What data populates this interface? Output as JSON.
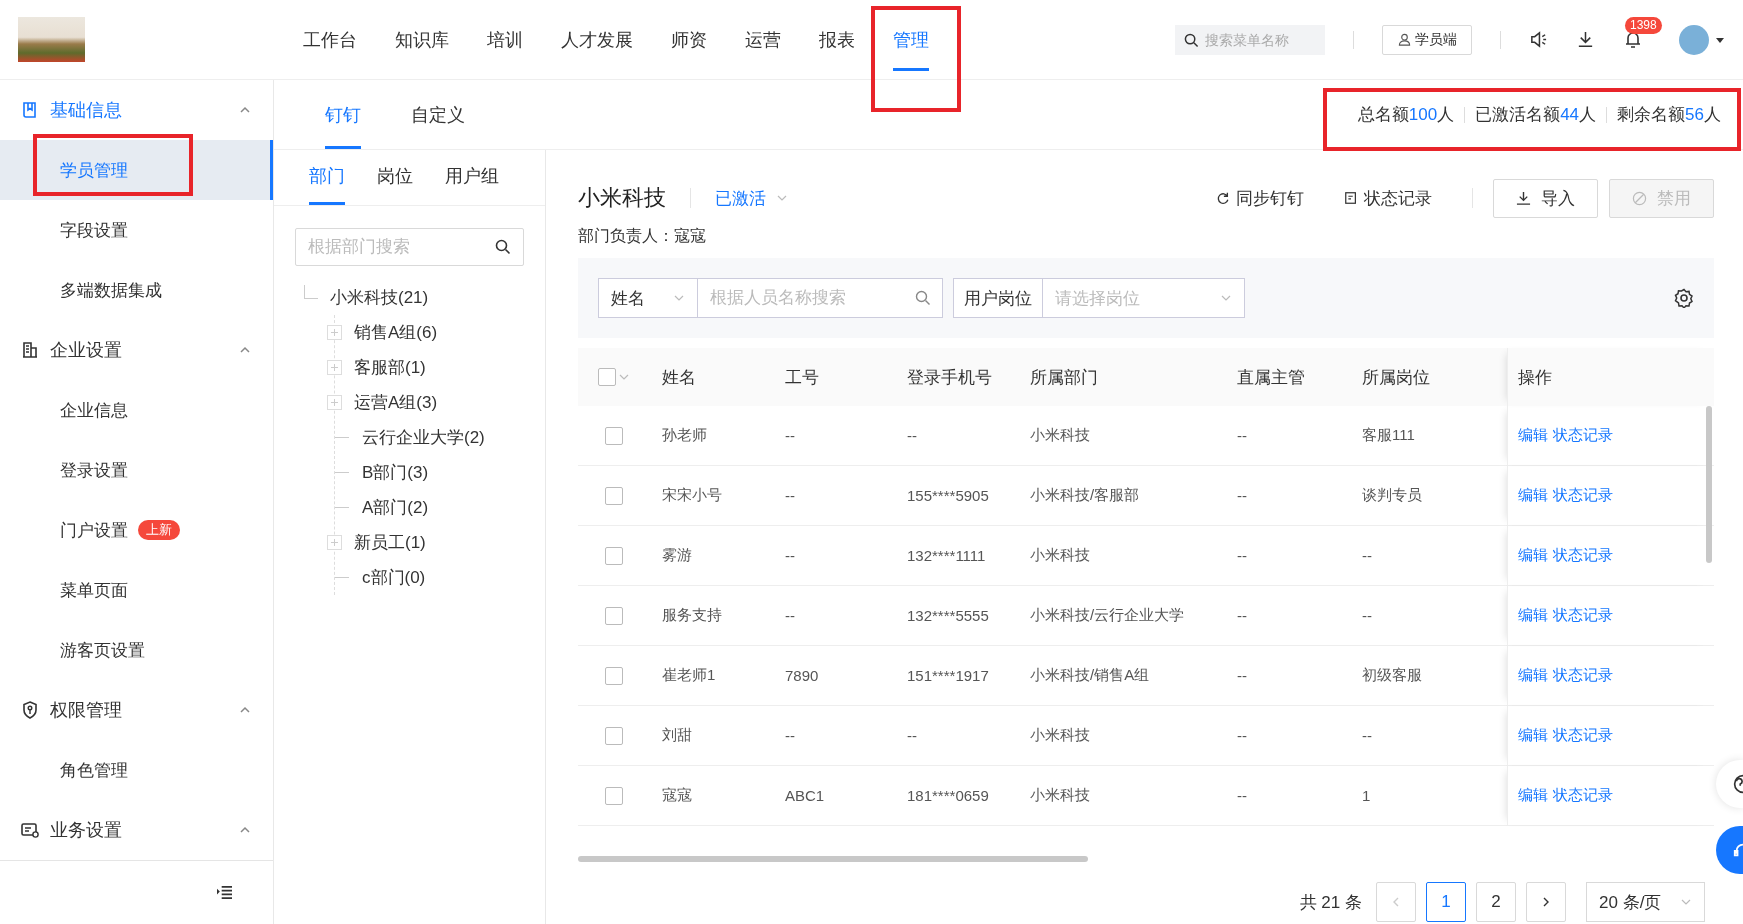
{
  "header": {
    "nav": [
      {
        "label": "工作台",
        "selected": false,
        "annotated": false
      },
      {
        "label": "知识库",
        "selected": false,
        "annotated": false
      },
      {
        "label": "培训",
        "selected": false,
        "annotated": false
      },
      {
        "label": "人才发展",
        "selected": false,
        "annotated": false
      },
      {
        "label": "师资",
        "selected": false,
        "annotated": false
      },
      {
        "label": "运营",
        "selected": false,
        "annotated": false
      },
      {
        "label": "报表",
        "selected": false,
        "annotated": false
      },
      {
        "label": "管理",
        "selected": true,
        "annotated": true
      }
    ],
    "search": {
      "placeholder": "搜索菜单名称"
    },
    "portal_button": "学员端",
    "notification_count": "1398"
  },
  "sidebar": {
    "sections": [
      {
        "label": "基础信息",
        "kind": "book",
        "selected": true,
        "expanded": true,
        "items": [
          {
            "label": "学员管理",
            "selected": true,
            "annotated": true
          },
          {
            "label": "字段设置",
            "selected": false,
            "annotated": false
          },
          {
            "label": "多端数据集成",
            "selected": false,
            "annotated": false
          }
        ]
      },
      {
        "label": "企业设置",
        "kind": "building",
        "selected": false,
        "expanded": true,
        "items": [
          {
            "label": "企业信息",
            "selected": false,
            "annotated": false
          },
          {
            "label": "登录设置",
            "selected": false,
            "annotated": false
          },
          {
            "label": "门户设置",
            "selected": false,
            "annotated": false,
            "badge": "上新"
          },
          {
            "label": "菜单页面",
            "selected": false,
            "annotated": false
          },
          {
            "label": "游客页设置",
            "selected": false,
            "annotated": false
          }
        ]
      },
      {
        "label": "权限管理",
        "kind": "shield",
        "selected": false,
        "expanded": true,
        "items": [
          {
            "label": "角色管理",
            "selected": false,
            "annotated": false
          }
        ]
      },
      {
        "label": "业务设置",
        "kind": "card",
        "selected": false,
        "expanded": true
      }
    ]
  },
  "sub_tabs": [
    {
      "label": "钉钉",
      "selected": true
    },
    {
      "label": "自定义",
      "selected": false
    }
  ],
  "quota": {
    "annotated": true,
    "items": [
      {
        "label": "总名额",
        "value": "100",
        "unit": "人"
      },
      {
        "label": "已激活名额",
        "value": "44",
        "unit": "人"
      },
      {
        "label": "剩余名额",
        "value": "56",
        "unit": "人"
      }
    ]
  },
  "tree_panel": {
    "tabs": [
      {
        "label": "部门",
        "selected": true
      },
      {
        "label": "岗位",
        "selected": false
      },
      {
        "label": "用户组",
        "selected": false
      }
    ],
    "search": {
      "placeholder": "根据部门搜索"
    },
    "tree": {
      "label": "小米科技(21)",
      "children": [
        {
          "label": "销售A组(6)",
          "expandable": true
        },
        {
          "label": "客服部(1)",
          "expandable": true
        },
        {
          "label": "运营A组(3)",
          "expandable": true
        },
        {
          "label": "云行企业大学(2)",
          "expandable": false
        },
        {
          "label": "B部门(3)",
          "expandable": false
        },
        {
          "label": "A部门(2)",
          "expandable": false
        },
        {
          "label": "新员工(1)",
          "expandable": true
        },
        {
          "label": "c部门(0)",
          "expandable": false
        }
      ]
    }
  },
  "org": {
    "title": "小米科技",
    "status": "已激活",
    "sync_button": "同步钉钉",
    "log_button": "状态记录",
    "import_button": "导入",
    "disable_button": {
      "label": "禁用",
      "disabled": true
    },
    "manager": "部门负责人：寇寇"
  },
  "filters": {
    "field": "姓名",
    "search_placeholder": "根据人员名称搜索",
    "post_label": "用户岗位",
    "post_placeholder": "请选择岗位"
  },
  "table": {
    "select_all_checked": false,
    "columns": [
      "姓名",
      "工号",
      "登录手机号",
      "所属部门",
      "直属主管",
      "所属岗位",
      "操作"
    ],
    "rows": [
      {
        "checked": false,
        "cells": [
          "孙老师",
          "--",
          "--",
          "小米科技",
          "--",
          "客服111"
        ],
        "actions": [
          "编辑",
          "状态记录"
        ]
      },
      {
        "checked": false,
        "cells": [
          "宋宋小号",
          "--",
          "155****5905",
          "小米科技/客服部",
          "--",
          "谈判专员"
        ],
        "actions": [
          "编辑",
          "状态记录"
        ]
      },
      {
        "checked": false,
        "cells": [
          "雾游",
          "--",
          "132****1111",
          "小米科技",
          "--",
          "--"
        ],
        "actions": [
          "编辑",
          "状态记录"
        ]
      },
      {
        "checked": false,
        "cells": [
          "服务支持",
          "--",
          "132****5555",
          "小米科技/云行企业大学",
          "--",
          "--"
        ],
        "actions": [
          "编辑",
          "状态记录"
        ]
      },
      {
        "checked": false,
        "cells": [
          "崔老师1",
          "7890",
          "151****1917",
          "小米科技/销售A组",
          "--",
          "初级客服"
        ],
        "actions": [
          "编辑",
          "状态记录"
        ]
      },
      {
        "checked": false,
        "cells": [
          "刘甜",
          "--",
          "--",
          "小米科技",
          "--",
          "--"
        ],
        "actions": [
          "编辑",
          "状态记录"
        ]
      },
      {
        "checked": false,
        "cells": [
          "寇寇",
          "ABC1",
          "181****0659",
          "小米科技",
          "--",
          "1"
        ],
        "actions": [
          "编辑",
          "状态记录"
        ]
      }
    ]
  },
  "pagination": {
    "total": "共 21 条",
    "pages": [
      {
        "label": "1",
        "selected": true
      },
      {
        "label": "2",
        "selected": false
      }
    ],
    "page_size": "20 条/页"
  }
}
